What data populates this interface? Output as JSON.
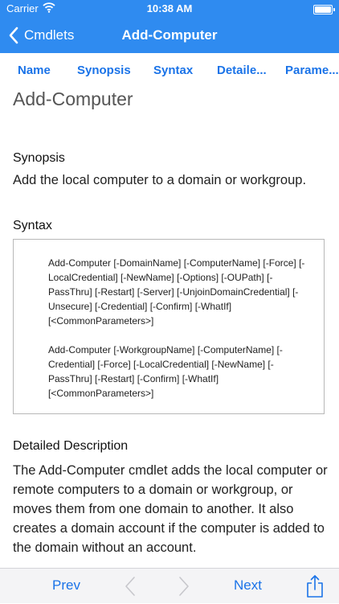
{
  "status_bar": {
    "carrier": "Carrier",
    "time": "10:38 AM"
  },
  "nav": {
    "back_label": "Cmdlets",
    "title": "Add-Computer"
  },
  "tabs": [
    {
      "label": "Name"
    },
    {
      "label": "Synopsis"
    },
    {
      "label": "Syntax"
    },
    {
      "label": "Detaile..."
    },
    {
      "label": "Parame..."
    }
  ],
  "page": {
    "title": "Add-Computer",
    "synopsis_heading": "Synopsis",
    "synopsis_text": "Add the local computer to a domain or workgroup.",
    "syntax_heading": "Syntax",
    "syntax": [
      "Add-Computer [-DomainName] [-ComputerName] [-Force] [-LocalCredential] [-NewName] [-Options] [-OUPath] [-PassThru] [-Restart] [-Server] [-UnjoinDomainCredential] [-Unsecure] [-Credential] [-Confirm] [-WhatIf] [<CommonParameters>]",
      "Add-Computer [-WorkgroupName] [-ComputerName] [-Credential] [-Force] [-LocalCredential] [-NewName] [-PassThru] [-Restart] [-Confirm] [-WhatIf] [<CommonParameters>]"
    ],
    "description_heading": "Detailed Description",
    "description_text": "The Add-Computer cmdlet adds the local computer or remote computers to a domain or workgroup, or moves them from one domain to another. It also creates a domain account if the computer is added to the domain without an account."
  },
  "toolbar": {
    "prev_label": "Prev",
    "next_label": "Next"
  },
  "icons": {
    "back": "chevron-left-icon",
    "wifi": "wifi-icon",
    "battery": "battery-icon",
    "prev_arrow": "chevron-left-icon",
    "next_arrow": "chevron-right-icon",
    "share": "share-icon"
  },
  "colors": {
    "accent": "#2f8bf0",
    "link": "#1a73e8",
    "toolbar_bg": "#f4f4f6"
  }
}
